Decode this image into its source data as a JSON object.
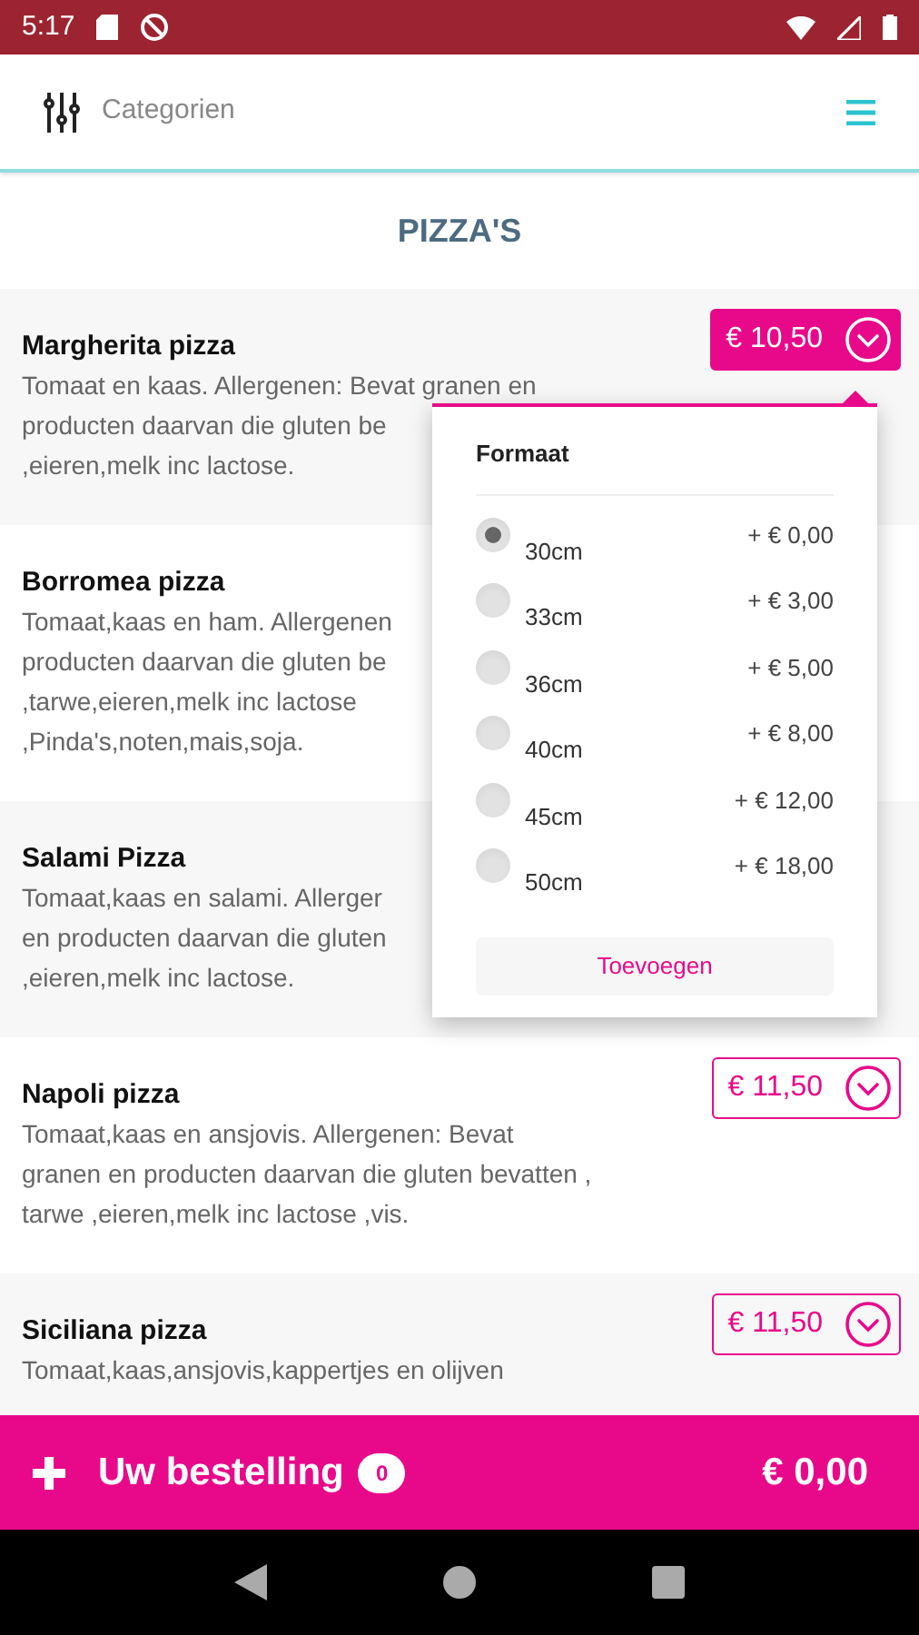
{
  "status_bar": {
    "time": "5:17"
  },
  "header": {
    "categories_label": "Categorien"
  },
  "section_title": "PIZZA'S",
  "items": [
    {
      "name": "Margherita pizza",
      "description_lines": [
        "Tomaat en kaas. Allergenen: Bevat granen en",
        "producten daarvan die gluten be",
        ",eieren,melk inc lactose."
      ],
      "price": "€ 10,50",
      "selected": true
    },
    {
      "name": "Borromea pizza",
      "description_lines": [
        "Tomaat,kaas en ham. Allergenen",
        "producten daarvan die gluten be",
        ",tarwe,eieren,melk inc lactose",
        ",Pinda's,noten,mais,soja."
      ]
    },
    {
      "name": "Salami Pizza",
      "description_lines": [
        "Tomaat,kaas en salami. Allerger",
        "en producten daarvan die gluten",
        ",eieren,melk inc lactose."
      ]
    },
    {
      "name": "Napoli pizza",
      "description_lines": [
        "Tomaat,kaas en ansjovis. Allergenen: Bevat",
        "granen en producten daarvan die gluten bevatten ,",
        "tarwe ,eieren,melk inc lactose ,vis."
      ],
      "price": "€ 11,50",
      "selected": false
    },
    {
      "name": "Siciliana pizza",
      "description_lines": [
        "Tomaat,kaas,ansjovis,kappertjes en olijven"
      ],
      "price": "€ 11,50",
      "selected": false
    }
  ],
  "popover": {
    "title": "Formaat",
    "options": [
      {
        "label": "30cm",
        "extra": "+ € 0,00",
        "selected": true
      },
      {
        "label": "33cm",
        "extra": "+ € 3,00",
        "selected": false
      },
      {
        "label": "36cm",
        "extra": "+ € 5,00",
        "selected": false
      },
      {
        "label": "40cm",
        "extra": "+ € 8,00",
        "selected": false
      },
      {
        "label": "45cm",
        "extra": "+ € 12,00",
        "selected": false
      },
      {
        "label": "50cm",
        "extra": "+ € 18,00",
        "selected": false
      }
    ],
    "button": "Toevoegen"
  },
  "order_bar": {
    "label": "Uw bestelling",
    "count": "0",
    "total": "€ 0,00"
  }
}
